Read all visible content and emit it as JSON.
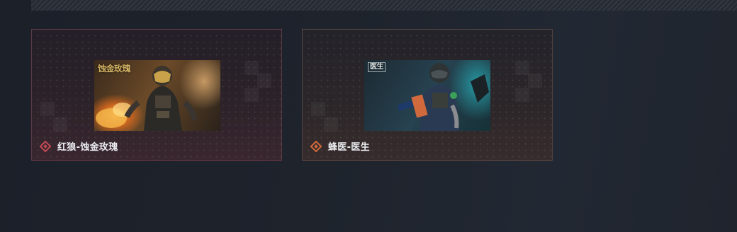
{
  "cards": [
    {
      "label": "红狼-蚀金玫瑰",
      "image_art_title": "蚀金玫瑰",
      "accent_color": "#c24a55",
      "image_alt": "soldier in gold-visored helmet with flames"
    },
    {
      "label": "蜂医-医生",
      "image_art_title": "医生",
      "accent_color": "#d06a3c",
      "image_alt": "medic soldier in helmet kneeling"
    }
  ],
  "icons": {
    "card_marker": "diamond-icon"
  }
}
